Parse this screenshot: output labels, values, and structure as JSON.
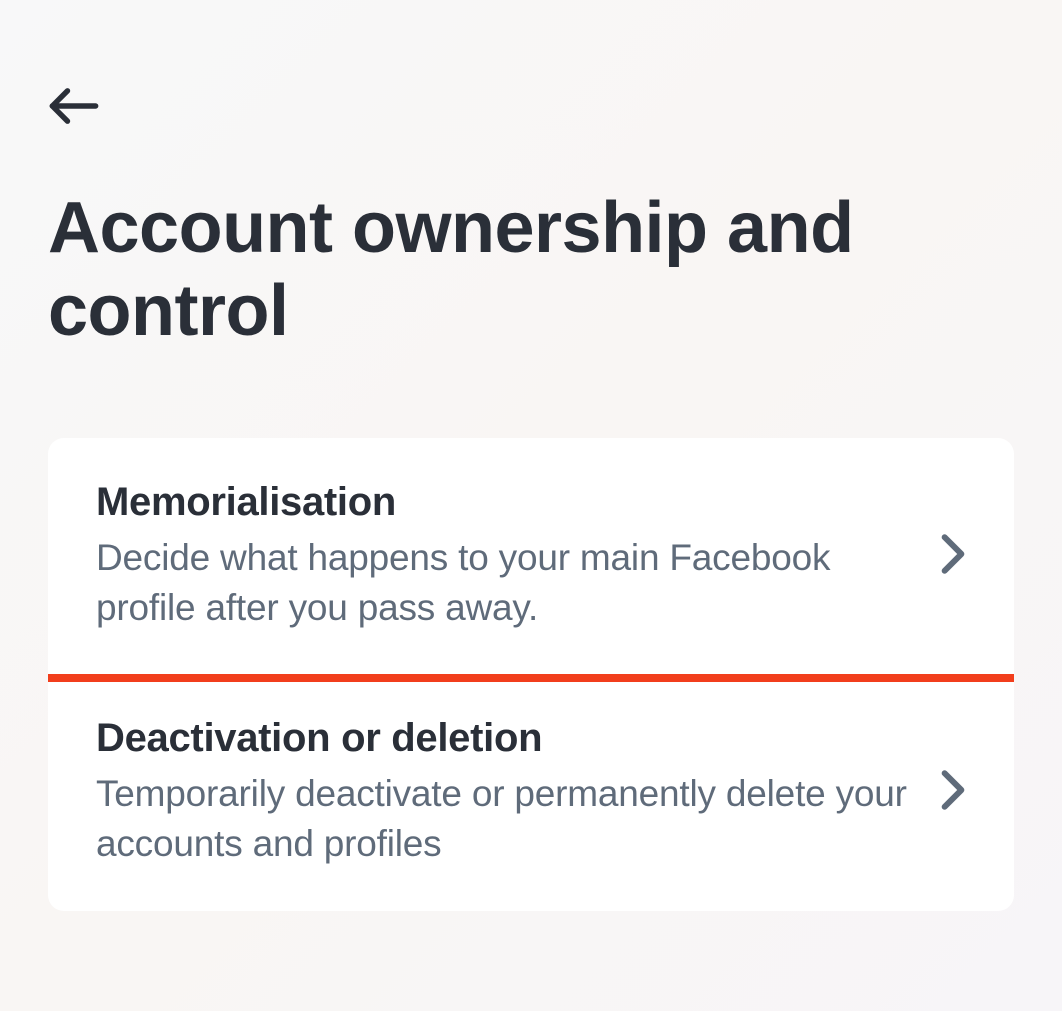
{
  "page": {
    "title": "Account ownership and control"
  },
  "settings": {
    "items": [
      {
        "title": "Memorialisation",
        "description": "Decide what happens to your main Facebook profile after you pass away."
      },
      {
        "title": "Deactivation or deletion",
        "description": "Temporarily deactivate or permanently delete your accounts and profiles"
      }
    ]
  }
}
